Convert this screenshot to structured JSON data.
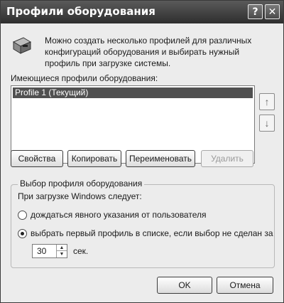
{
  "window": {
    "title": "Профили оборудования",
    "help_label": "?",
    "close_label": "✕"
  },
  "info": {
    "text": "Можно создать несколько профилей для различных конфигураций оборудования и выбирать нужный профиль при загрузке системы.",
    "icon": "computer-hardware-icon"
  },
  "profiles": {
    "label": "Имеющиеся профили оборудования:",
    "items": [
      "Profile 1 (Текущий)"
    ],
    "selected_index": 0
  },
  "arrows": {
    "up": "↑",
    "down": "↓"
  },
  "buttons": {
    "properties": "Свойства",
    "copy": "Копировать",
    "rename": "Переименовать",
    "delete": "Удалить",
    "ok": "OK",
    "cancel": "Отмена"
  },
  "selection": {
    "group_title": "Выбор профиля оборудования",
    "subtitle": "При загрузке Windows следует:",
    "option_wait": "дождаться явного указания от пользователя",
    "option_first": "выбрать первый профиль в списке, если выбор не сделан за",
    "selected_option": "option_first",
    "timeout_value": "30",
    "timeout_unit": "сек."
  },
  "colors": {
    "titlebar": "#3e3e3e",
    "selection": "#505050",
    "dialog_bg": "#ececec"
  }
}
